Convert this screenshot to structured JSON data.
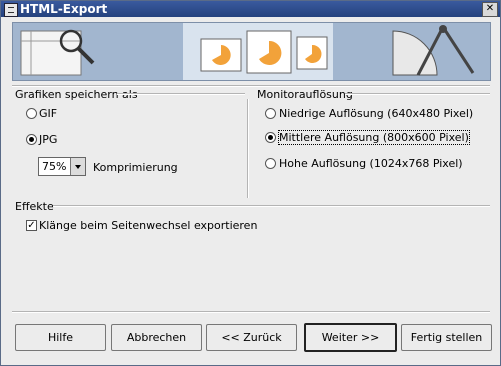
{
  "window": {
    "title": "HTML-Export"
  },
  "graphics_group": {
    "title": "Grafiken speichern als",
    "gif_label": "GIF",
    "jpg_label": "JPG",
    "selected": "JPG",
    "compression_value": "75%",
    "compression_label": "Komprimierung"
  },
  "resolution_group": {
    "title": "Monitorauflösung",
    "low_label": "Niedrige Auflösung (640x480 Pixel)",
    "medium_label": "Mittlere Auflösung (800x600 Pixel)",
    "high_label": "Hohe Auflösung (1024x768 Pixel)",
    "selected": "Mittlere Auflösung (800x600 Pixel)"
  },
  "effects_group": {
    "title": "Effekte",
    "sounds_label": "Klänge beim Seitenwechsel exportieren",
    "sounds_checked": true
  },
  "buttons": {
    "help": "Hilfe",
    "cancel": "Abbrechen",
    "back": "<< Zurück",
    "next": "Weiter >>",
    "finish": "Fertig stellen"
  }
}
